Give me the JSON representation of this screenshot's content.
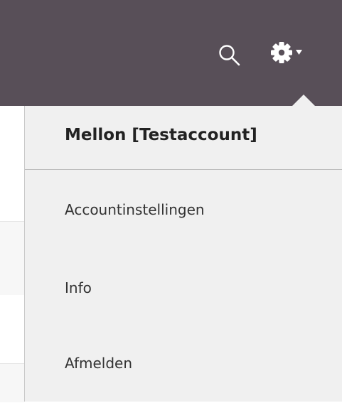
{
  "header": {
    "icons": {
      "search": "search-icon",
      "settings": "gear-icon",
      "caret": "caret-down-icon"
    },
    "colors": {
      "bar": "#584f58",
      "icon": "#ffffff",
      "menu_bg": "#f0f0f0"
    }
  },
  "menu": {
    "account_name": "Mellon [Testaccount]",
    "items": [
      {
        "label": "Accountinstellingen"
      },
      {
        "label": "Info"
      },
      {
        "label": "Afmelden"
      }
    ]
  }
}
